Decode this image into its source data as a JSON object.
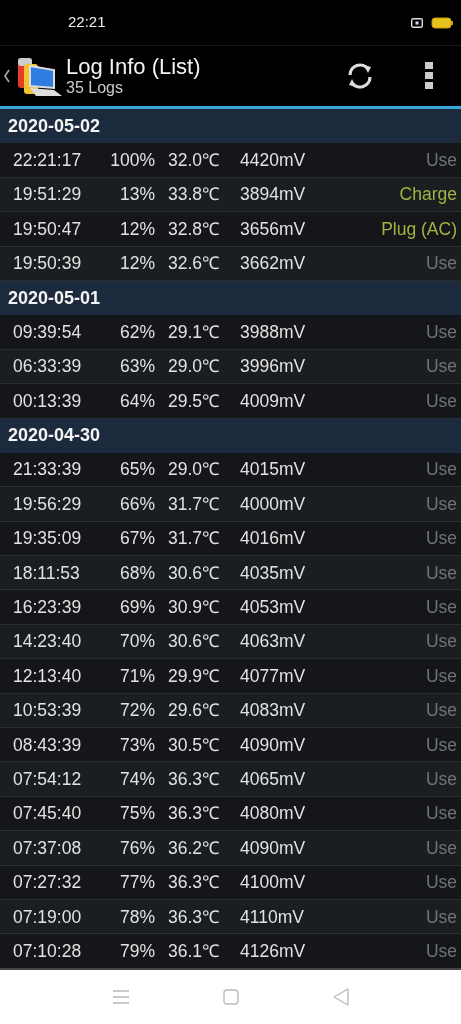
{
  "status_bar": {
    "time": "22:21"
  },
  "app_bar": {
    "title": "Log Info (List)",
    "subtitle": "35 Logs"
  },
  "groups": [
    {
      "date": "2020-05-02",
      "rows": [
        {
          "time": "22:21:17",
          "percent": "100%",
          "temp": "32.0℃",
          "voltage": "4420mV",
          "event": "Use",
          "kind": "use"
        },
        {
          "time": "19:51:29",
          "percent": "13%",
          "temp": "33.8℃",
          "voltage": "3894mV",
          "event": "Charge",
          "kind": "charge"
        },
        {
          "time": "19:50:47",
          "percent": "12%",
          "temp": "32.8℃",
          "voltage": "3656mV",
          "event": "Plug (AC)",
          "kind": "charge"
        },
        {
          "time": "19:50:39",
          "percent": "12%",
          "temp": "32.6℃",
          "voltage": "3662mV",
          "event": "Use",
          "kind": "use"
        }
      ]
    },
    {
      "date": "2020-05-01",
      "rows": [
        {
          "time": "09:39:54",
          "percent": "62%",
          "temp": "29.1℃",
          "voltage": "3988mV",
          "event": "Use",
          "kind": "use"
        },
        {
          "time": "06:33:39",
          "percent": "63%",
          "temp": "29.0℃",
          "voltage": "3996mV",
          "event": "Use",
          "kind": "use"
        },
        {
          "time": "00:13:39",
          "percent": "64%",
          "temp": "29.5℃",
          "voltage": "4009mV",
          "event": "Use",
          "kind": "use"
        }
      ]
    },
    {
      "date": "2020-04-30",
      "rows": [
        {
          "time": "21:33:39",
          "percent": "65%",
          "temp": "29.0℃",
          "voltage": "4015mV",
          "event": "Use",
          "kind": "use"
        },
        {
          "time": "19:56:29",
          "percent": "66%",
          "temp": "31.7℃",
          "voltage": "4000mV",
          "event": "Use",
          "kind": "use"
        },
        {
          "time": "19:35:09",
          "percent": "67%",
          "temp": "31.7℃",
          "voltage": "4016mV",
          "event": "Use",
          "kind": "use"
        },
        {
          "time": "18:11:53",
          "percent": "68%",
          "temp": "30.6℃",
          "voltage": "4035mV",
          "event": "Use",
          "kind": "use"
        },
        {
          "time": "16:23:39",
          "percent": "69%",
          "temp": "30.9℃",
          "voltage": "4053mV",
          "event": "Use",
          "kind": "use"
        },
        {
          "time": "14:23:40",
          "percent": "70%",
          "temp": "30.6℃",
          "voltage": "4063mV",
          "event": "Use",
          "kind": "use"
        },
        {
          "time": "12:13:40",
          "percent": "71%",
          "temp": "29.9℃",
          "voltage": "4077mV",
          "event": "Use",
          "kind": "use"
        },
        {
          "time": "10:53:39",
          "percent": "72%",
          "temp": "29.6℃",
          "voltage": "4083mV",
          "event": "Use",
          "kind": "use"
        },
        {
          "time": "08:43:39",
          "percent": "73%",
          "temp": "30.5℃",
          "voltage": "4090mV",
          "event": "Use",
          "kind": "use"
        },
        {
          "time": "07:54:12",
          "percent": "74%",
          "temp": "36.3℃",
          "voltage": "4065mV",
          "event": "Use",
          "kind": "use"
        },
        {
          "time": "07:45:40",
          "percent": "75%",
          "temp": "36.3℃",
          "voltage": "4080mV",
          "event": "Use",
          "kind": "use"
        },
        {
          "time": "07:37:08",
          "percent": "76%",
          "temp": "36.2℃",
          "voltage": "4090mV",
          "event": "Use",
          "kind": "use"
        },
        {
          "time": "07:27:32",
          "percent": "77%",
          "temp": "36.3℃",
          "voltage": "4100mV",
          "event": "Use",
          "kind": "use"
        },
        {
          "time": "07:19:00",
          "percent": "78%",
          "temp": "36.3℃",
          "voltage": "4110mV",
          "event": "Use",
          "kind": "use"
        },
        {
          "time": "07:10:28",
          "percent": "79%",
          "temp": "36.1℃",
          "voltage": "4126mV",
          "event": "Use",
          "kind": "use"
        }
      ]
    }
  ]
}
